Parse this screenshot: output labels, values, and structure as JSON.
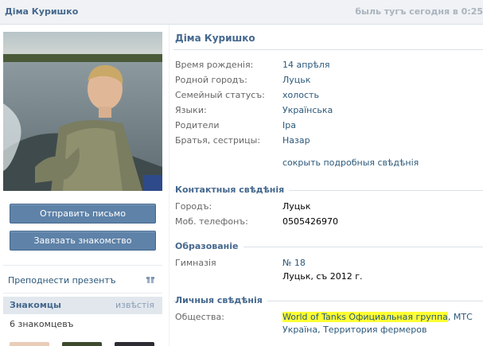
{
  "header": {
    "name": "Діма Куришко",
    "online_status": "быль тугъ сегодня в 0:25"
  },
  "actions": {
    "send_message": "Отправить письмо",
    "add_friend": "Завязать знакомство",
    "give_gift": "Преподнести презентъ"
  },
  "friends": {
    "title": "Знакомцы",
    "all_link": "извѣстія",
    "count": "6 знакомцевъ"
  },
  "profile": {
    "name": "Діма Куришко",
    "info_rows": [
      {
        "label": "Время рожденія:",
        "value": "14 апрѣля"
      },
      {
        "label": "Родной городъ:",
        "value": "Луцьк"
      },
      {
        "label": "Семейный статусъ:",
        "value": "холость"
      },
      {
        "label": "Языки:",
        "value": "Українська"
      },
      {
        "label": "Родители",
        "value": "Іра"
      },
      {
        "label": "Братья, сестрицы:",
        "value": "Назар"
      }
    ],
    "hide_details": "сокрыть подробныя свѣдѣнія"
  },
  "contact": {
    "title": "Контактныя свѣдѣнія",
    "rows": [
      {
        "label": "Городъ:",
        "value": "Луцьк"
      },
      {
        "label": "Моб. телефонъ:",
        "value": "0505426970"
      }
    ]
  },
  "education": {
    "title": "Образованіе",
    "school_label": "Гимназія",
    "school_number": "№ 18",
    "school_detail": "Луцьк, съ 2012 г."
  },
  "personal": {
    "title": "Личныя свѣдѣнія",
    "communities_label": "Общества:",
    "community_1": "World of Tanks Официальная группа",
    "community_sep_1": ", ",
    "community_2": "МТС Україна",
    "community_sep_2": ", ",
    "community_3": "Территория фермеров"
  },
  "colors": {
    "accent": "#45688e",
    "link": "#2b587a",
    "button": "#5e82a8",
    "highlight": "#ffff33"
  }
}
